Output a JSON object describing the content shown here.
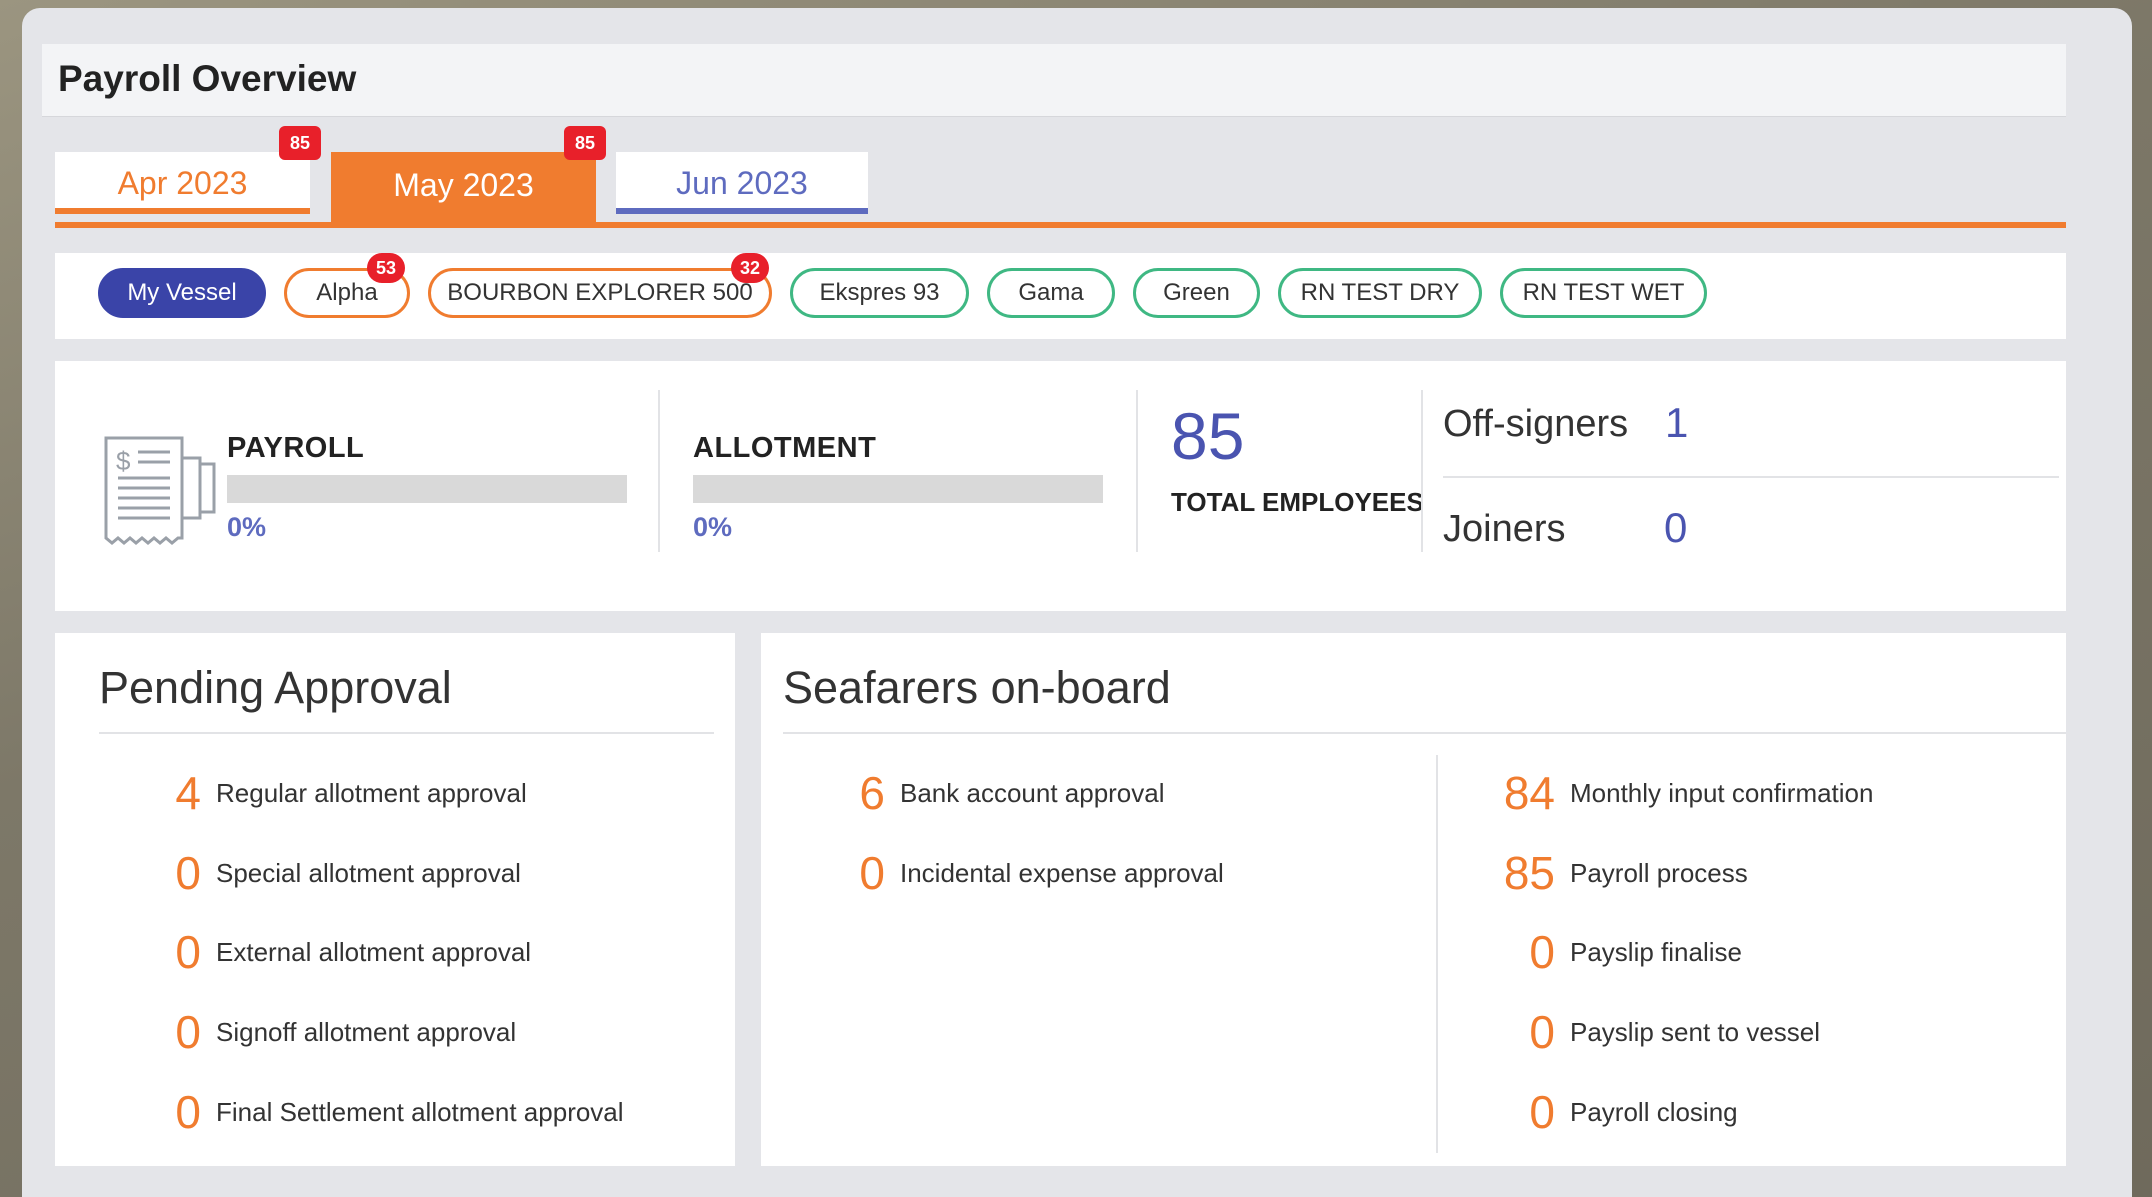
{
  "title": "Payroll Overview",
  "month_tabs": [
    {
      "label": "Apr 2023",
      "badge": "85"
    },
    {
      "label": "May 2023",
      "badge": "85",
      "active": true
    },
    {
      "label": "Jun 2023"
    }
  ],
  "vessels": [
    {
      "label": "My Vessel",
      "active": true
    },
    {
      "label": "Alpha",
      "badge": "53"
    },
    {
      "label": "BOURBON EXPLORER 500",
      "badge": "32"
    },
    {
      "label": "Ekspres 93"
    },
    {
      "label": "Gama"
    },
    {
      "label": "Green"
    },
    {
      "label": "RN TEST DRY"
    },
    {
      "label": "RN TEST WET"
    }
  ],
  "stats": {
    "payroll": {
      "label": "PAYROLL",
      "percent": "0%",
      "progress": 0
    },
    "allotment": {
      "label": "ALLOTMENT",
      "percent": "0%",
      "progress": 0
    },
    "total_employees": {
      "value": "85",
      "label": "TOTAL EMPLOYEES"
    },
    "off_signers": {
      "label": "Off-signers",
      "value": "1"
    },
    "joiners": {
      "label": "Joiners",
      "value": "0"
    }
  },
  "pending_approval": {
    "title": "Pending Approval",
    "items": [
      {
        "count": "4",
        "label": "Regular allotment approval"
      },
      {
        "count": "0",
        "label": "Special allotment approval"
      },
      {
        "count": "0",
        "label": "External allotment approval"
      },
      {
        "count": "0",
        "label": "Signoff allotment approval"
      },
      {
        "count": "0",
        "label": "Final Settlement allotment approval"
      }
    ]
  },
  "seafarers": {
    "title": "Seafarers on-board",
    "left_items": [
      {
        "count": "6",
        "label": "Bank account approval"
      },
      {
        "count": "0",
        "label": "Incidental expense approval"
      }
    ],
    "right_items": [
      {
        "count": "84",
        "label": "Monthly input confirmation"
      },
      {
        "count": "85",
        "label": "Payroll process"
      },
      {
        "count": "0",
        "label": "Payslip finalise"
      },
      {
        "count": "0",
        "label": "Payslip sent to vessel"
      },
      {
        "count": "0",
        "label": "Payroll closing"
      }
    ]
  },
  "colors": {
    "accent": "#f07c2f",
    "primary": "#3a44a8",
    "badge": "#e8202a",
    "green": "#3fb883"
  }
}
